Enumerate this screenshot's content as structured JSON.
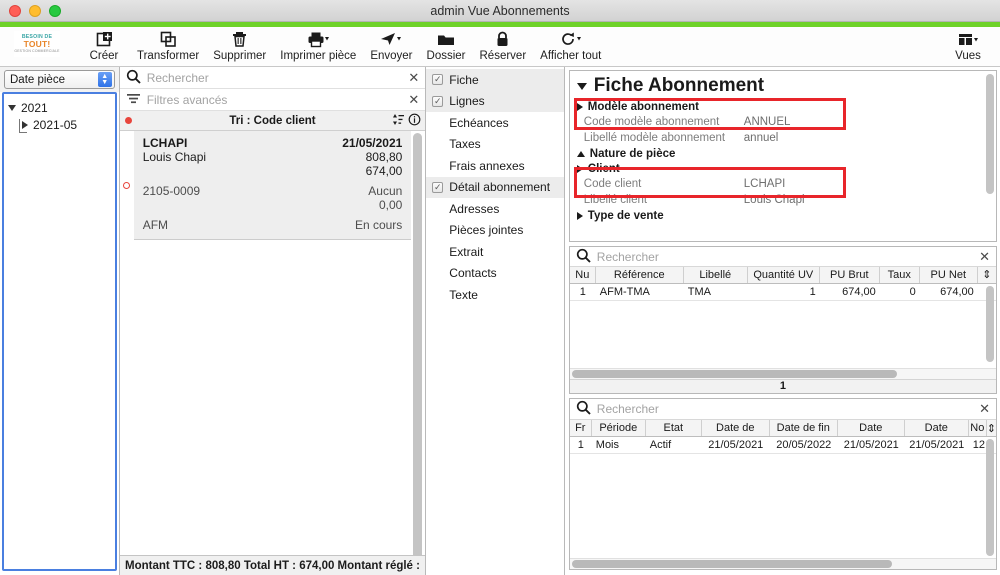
{
  "window": {
    "title": "admin Vue Abonnements",
    "accent_green": "#6ed228",
    "highlight_red": "#e8252a"
  },
  "toolbar": {
    "logo": {
      "line1": "BESOIN DE",
      "line2": "TOUT!",
      "line3": "GESTION COMMERCIALE"
    },
    "buttons": [
      {
        "label": "Créer",
        "icon": "create-icon",
        "has_caret": false
      },
      {
        "label": "Transformer",
        "icon": "transform-icon",
        "has_caret": false
      },
      {
        "label": "Supprimer",
        "icon": "trash-icon",
        "has_caret": false
      },
      {
        "label": "Imprimer pièce",
        "icon": "printer-icon",
        "has_caret": true
      },
      {
        "label": "Envoyer",
        "icon": "send-icon",
        "has_caret": true
      },
      {
        "label": "Dossier",
        "icon": "folder-icon",
        "has_caret": false
      },
      {
        "label": "Réserver",
        "icon": "lock-icon",
        "has_caret": false
      },
      {
        "label": "Afficher tout",
        "icon": "refresh-icon",
        "has_caret": true
      }
    ],
    "views_button": {
      "label": "Vues",
      "icon": "views-icon",
      "has_caret": true
    }
  },
  "left_panel": {
    "sort_select": {
      "value": "Date pièce"
    },
    "tree": [
      {
        "label": "2021",
        "level": 1,
        "expanded": true
      },
      {
        "label": "2021-05",
        "level": 2,
        "expanded": false
      }
    ]
  },
  "list_panel": {
    "search": {
      "placeholder": "Rechercher"
    },
    "advanced_filters": {
      "label": "Filtres avancés"
    },
    "sort_header": "Tri : Code client",
    "cards": [
      {
        "code": "LCHAPI",
        "name": "Louis Chapi",
        "reference": "2105-0009",
        "type": "AFM",
        "date": "21/05/2021",
        "amount_ttc": "808,80",
        "amount_ht": "674,00",
        "payment": "Aucun",
        "balance": "0,00",
        "status": "En cours"
      }
    ],
    "status_bar": "Montant TTC : 808,80 Total HT : 674,00 Montant réglé :"
  },
  "nav_panel": {
    "items": [
      {
        "label": "Fiche",
        "checked": true,
        "selected": true
      },
      {
        "label": "Lignes",
        "checked": true,
        "selected": true
      },
      {
        "label": "Echéances",
        "checked": false,
        "selected": false
      },
      {
        "label": "Taxes",
        "checked": false,
        "selected": false
      },
      {
        "label": "Frais annexes",
        "checked": false,
        "selected": false
      },
      {
        "label": "Détail abonnement",
        "checked": true,
        "selected": true
      },
      {
        "label": "Adresses",
        "checked": false,
        "selected": false
      },
      {
        "label": "Pièces jointes",
        "checked": false,
        "selected": false
      },
      {
        "label": "Extrait",
        "checked": false,
        "selected": false
      },
      {
        "label": "Contacts",
        "checked": false,
        "selected": false
      },
      {
        "label": "Texte",
        "checked": false,
        "selected": false
      }
    ]
  },
  "fiche": {
    "title": "Fiche Abonnement",
    "groups": [
      {
        "label": "Modèle abonnement",
        "state": "collapsed",
        "highlighted": true
      },
      {
        "label": "Nature de pièce",
        "state": "expanded",
        "highlighted": false
      },
      {
        "label": "Client",
        "state": "collapsed",
        "highlighted": true
      },
      {
        "label": "Type de vente",
        "state": "collapsed",
        "highlighted": false
      }
    ],
    "fields": {
      "code_modele_label": "Code modèle abonnement",
      "code_modele_value": "ANNUEL",
      "libelle_modele_label": "Libellé modèle abonnement",
      "libelle_modele_value": "annuel",
      "code_client_label": "Code client",
      "code_client_value": "LCHAPI",
      "libelle_client_label": "Libellé client",
      "libelle_client_value": "Louis Chapi"
    }
  },
  "lines_table": {
    "search": {
      "placeholder": "Rechercher"
    },
    "columns": [
      "Nu",
      "Référence",
      "Libellé",
      "Quantité UV",
      "PU Brut",
      "Taux",
      "PU Net"
    ],
    "rows": [
      {
        "num": "1",
        "reference": "AFM-TMA",
        "libelle": "TMA",
        "quantite": "1",
        "pu_brut": "674,00",
        "taux": "0",
        "pu_net": "674,00"
      }
    ],
    "count": "1"
  },
  "detail_table": {
    "search": {
      "placeholder": "Rechercher"
    },
    "columns": [
      "Fr",
      "Période",
      "Etat",
      "Date de",
      "Date de fin",
      "Date",
      "Date",
      "No"
    ],
    "rows": [
      {
        "fr": "1",
        "periode": "Mois",
        "etat": "Actif",
        "date_de": "21/05/2021",
        "date_fin": "20/05/2022",
        "date3": "21/05/2021",
        "date4": "21/05/2021",
        "no": "12"
      }
    ]
  }
}
